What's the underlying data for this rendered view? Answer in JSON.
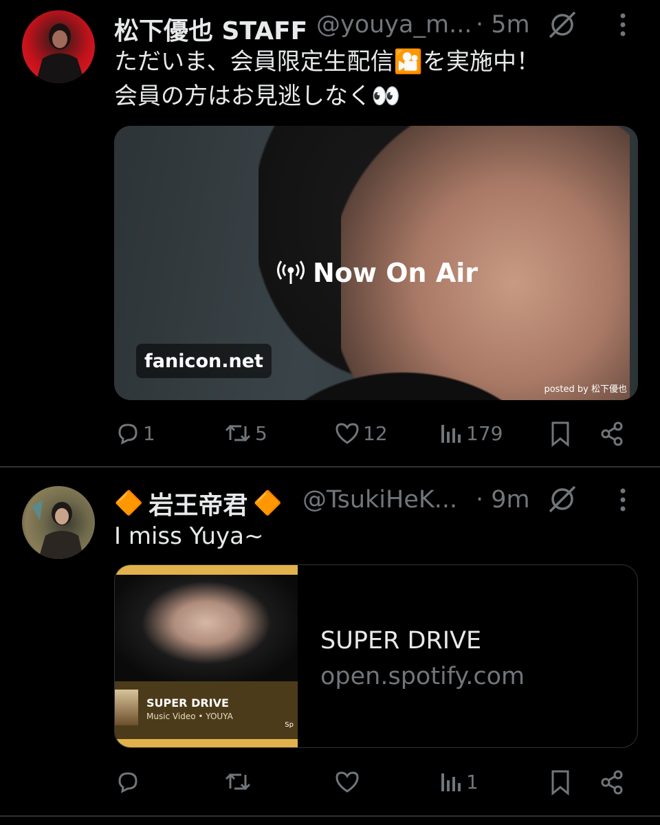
{
  "posts": [
    {
      "display_name": "松下優也 STAFF",
      "handle": "@youya_m...",
      "time": "· 5m",
      "text_lines": [
        "ただいま、会員限定生配信🎦を実施中！",
        "会員の方はお見逃しなく👀"
      ],
      "media": {
        "overlay_text": "Now On Air",
        "site_badge": "fanicon.net",
        "posted_by": "posted by 松下優也"
      },
      "stats": {
        "replies": "1",
        "reposts": "5",
        "likes": "12",
        "views": "179"
      }
    },
    {
      "name_prefix_emoji": "🔶",
      "display_name": "岩王帝君",
      "name_suffix_emoji": "🔶",
      "handle": "@TsukiHeK...",
      "time": "· 9m",
      "text_lines": [
        "I miss Yuya~"
      ],
      "card": {
        "thumb_title": "SUPER DRIVE",
        "thumb_subtitle": "Music Video • YOUYA",
        "thumb_brand": "Sp",
        "title": "SUPER DRIVE",
        "domain": "open.spotify.com"
      },
      "stats": {
        "replies": "",
        "reposts": "",
        "likes": "",
        "views": "1"
      }
    }
  ],
  "colors": {
    "background": "#000000",
    "text": "#e7e9ea",
    "muted": "#71767b",
    "divider": "#2f3336",
    "accent_gold": "#e2b24c"
  }
}
